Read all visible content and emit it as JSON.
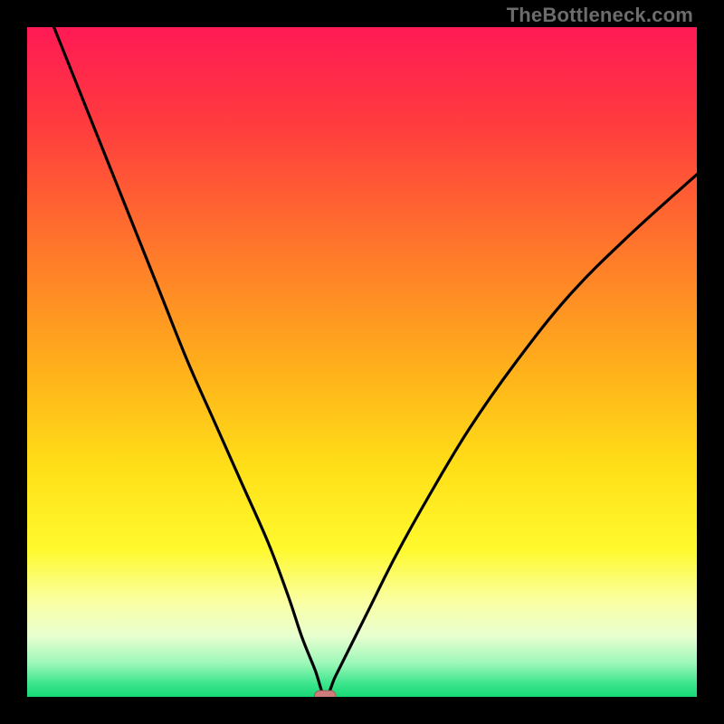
{
  "watermark": "TheBottleneck.com",
  "colors": {
    "frame": "#000000",
    "curve": "#000000",
    "marker_fill": "#cf7d7c",
    "marker_stroke": "#9c5a58",
    "gradient_stops": [
      {
        "offset": "0%",
        "color": "#ff1a55"
      },
      {
        "offset": "14%",
        "color": "#ff3a3f"
      },
      {
        "offset": "34%",
        "color": "#ff7a2a"
      },
      {
        "offset": "52%",
        "color": "#ffb31a"
      },
      {
        "offset": "66%",
        "color": "#ffe018"
      },
      {
        "offset": "78%",
        "color": "#fff92e"
      },
      {
        "offset": "86%",
        "color": "#faffa6"
      },
      {
        "offset": "91%",
        "color": "#e7ffd0"
      },
      {
        "offset": "95%",
        "color": "#9cf7b8"
      },
      {
        "offset": "98%",
        "color": "#3de58c"
      },
      {
        "offset": "100%",
        "color": "#17d877"
      }
    ]
  },
  "chart_data": {
    "type": "line",
    "title": "",
    "xlabel": "",
    "ylabel": "",
    "xlim": [
      0,
      100
    ],
    "ylim": [
      0,
      100
    ],
    "marker": {
      "x": 44.5,
      "y": 0,
      "w": 3.2,
      "h": 1.6
    },
    "notes": "V-shaped bottleneck curve. y is mismatch percentage (0 = optimal, green; 100 = worst, red). Minimum at x≈44.5.",
    "series": [
      {
        "name": "bottleneck-curve",
        "x": [
          4,
          8,
          12,
          16,
          20,
          24,
          28,
          32,
          36,
          39,
          41,
          43,
          44.5,
          46,
          48,
          51,
          55,
          60,
          66,
          73,
          81,
          90,
          100
        ],
        "y": [
          100,
          90,
          80,
          70,
          60,
          50,
          41,
          32,
          23,
          15,
          9,
          4,
          0,
          3,
          7,
          13,
          21,
          30,
          40,
          50,
          60,
          69,
          78
        ]
      }
    ]
  }
}
